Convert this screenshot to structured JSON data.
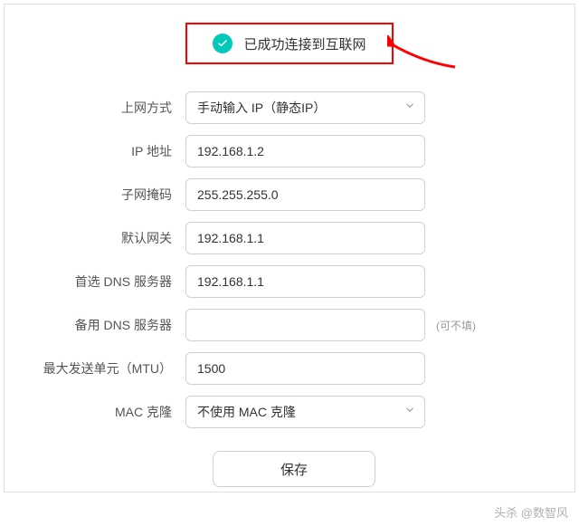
{
  "status": {
    "text": "已成功连接到互联网"
  },
  "form": {
    "connection_method": {
      "label": "上网方式",
      "value": "手动输入 IP（静态IP）"
    },
    "ip_address": {
      "label": "IP 地址",
      "value": "192.168.1.2"
    },
    "subnet_mask": {
      "label": "子网掩码",
      "value": "255.255.255.0"
    },
    "default_gateway": {
      "label": "默认网关",
      "value": "192.168.1.1"
    },
    "primary_dns": {
      "label": "首选 DNS 服务器",
      "value": "192.168.1.1"
    },
    "secondary_dns": {
      "label": "备用 DNS 服务器",
      "value": "",
      "hint": "(可不填)"
    },
    "mtu": {
      "label": "最大发送单元（MTU）",
      "value": "1500"
    },
    "mac_clone": {
      "label": "MAC 克隆",
      "value": "不使用 MAC 克隆"
    }
  },
  "buttons": {
    "save": "保存"
  },
  "watermark": "头杀 @数智风"
}
